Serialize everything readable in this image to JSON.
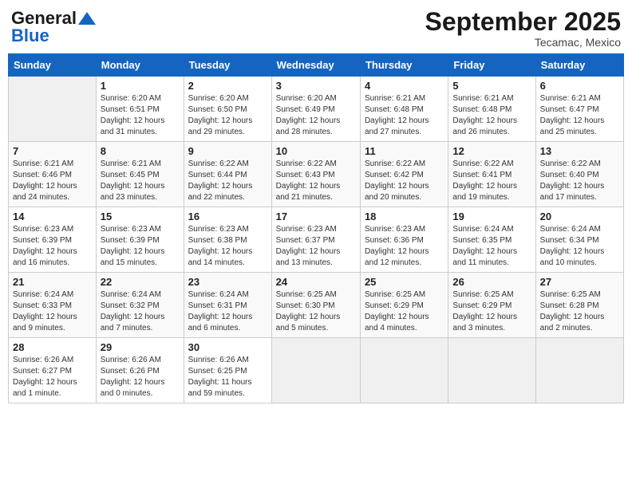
{
  "header": {
    "logo_line1": "General",
    "logo_line2": "Blue",
    "month_title": "September 2025",
    "location": "Tecamac, Mexico"
  },
  "weekdays": [
    "Sunday",
    "Monday",
    "Tuesday",
    "Wednesday",
    "Thursday",
    "Friday",
    "Saturday"
  ],
  "weeks": [
    [
      {
        "day": "",
        "info": ""
      },
      {
        "day": "1",
        "info": "Sunrise: 6:20 AM\nSunset: 6:51 PM\nDaylight: 12 hours\nand 31 minutes."
      },
      {
        "day": "2",
        "info": "Sunrise: 6:20 AM\nSunset: 6:50 PM\nDaylight: 12 hours\nand 29 minutes."
      },
      {
        "day": "3",
        "info": "Sunrise: 6:20 AM\nSunset: 6:49 PM\nDaylight: 12 hours\nand 28 minutes."
      },
      {
        "day": "4",
        "info": "Sunrise: 6:21 AM\nSunset: 6:48 PM\nDaylight: 12 hours\nand 27 minutes."
      },
      {
        "day": "5",
        "info": "Sunrise: 6:21 AM\nSunset: 6:48 PM\nDaylight: 12 hours\nand 26 minutes."
      },
      {
        "day": "6",
        "info": "Sunrise: 6:21 AM\nSunset: 6:47 PM\nDaylight: 12 hours\nand 25 minutes."
      }
    ],
    [
      {
        "day": "7",
        "info": "Sunrise: 6:21 AM\nSunset: 6:46 PM\nDaylight: 12 hours\nand 24 minutes."
      },
      {
        "day": "8",
        "info": "Sunrise: 6:21 AM\nSunset: 6:45 PM\nDaylight: 12 hours\nand 23 minutes."
      },
      {
        "day": "9",
        "info": "Sunrise: 6:22 AM\nSunset: 6:44 PM\nDaylight: 12 hours\nand 22 minutes."
      },
      {
        "day": "10",
        "info": "Sunrise: 6:22 AM\nSunset: 6:43 PM\nDaylight: 12 hours\nand 21 minutes."
      },
      {
        "day": "11",
        "info": "Sunrise: 6:22 AM\nSunset: 6:42 PM\nDaylight: 12 hours\nand 20 minutes."
      },
      {
        "day": "12",
        "info": "Sunrise: 6:22 AM\nSunset: 6:41 PM\nDaylight: 12 hours\nand 19 minutes."
      },
      {
        "day": "13",
        "info": "Sunrise: 6:22 AM\nSunset: 6:40 PM\nDaylight: 12 hours\nand 17 minutes."
      }
    ],
    [
      {
        "day": "14",
        "info": "Sunrise: 6:23 AM\nSunset: 6:39 PM\nDaylight: 12 hours\nand 16 minutes."
      },
      {
        "day": "15",
        "info": "Sunrise: 6:23 AM\nSunset: 6:39 PM\nDaylight: 12 hours\nand 15 minutes."
      },
      {
        "day": "16",
        "info": "Sunrise: 6:23 AM\nSunset: 6:38 PM\nDaylight: 12 hours\nand 14 minutes."
      },
      {
        "day": "17",
        "info": "Sunrise: 6:23 AM\nSunset: 6:37 PM\nDaylight: 12 hours\nand 13 minutes."
      },
      {
        "day": "18",
        "info": "Sunrise: 6:23 AM\nSunset: 6:36 PM\nDaylight: 12 hours\nand 12 minutes."
      },
      {
        "day": "19",
        "info": "Sunrise: 6:24 AM\nSunset: 6:35 PM\nDaylight: 12 hours\nand 11 minutes."
      },
      {
        "day": "20",
        "info": "Sunrise: 6:24 AM\nSunset: 6:34 PM\nDaylight: 12 hours\nand 10 minutes."
      }
    ],
    [
      {
        "day": "21",
        "info": "Sunrise: 6:24 AM\nSunset: 6:33 PM\nDaylight: 12 hours\nand 9 minutes."
      },
      {
        "day": "22",
        "info": "Sunrise: 6:24 AM\nSunset: 6:32 PM\nDaylight: 12 hours\nand 7 minutes."
      },
      {
        "day": "23",
        "info": "Sunrise: 6:24 AM\nSunset: 6:31 PM\nDaylight: 12 hours\nand 6 minutes."
      },
      {
        "day": "24",
        "info": "Sunrise: 6:25 AM\nSunset: 6:30 PM\nDaylight: 12 hours\nand 5 minutes."
      },
      {
        "day": "25",
        "info": "Sunrise: 6:25 AM\nSunset: 6:29 PM\nDaylight: 12 hours\nand 4 minutes."
      },
      {
        "day": "26",
        "info": "Sunrise: 6:25 AM\nSunset: 6:29 PM\nDaylight: 12 hours\nand 3 minutes."
      },
      {
        "day": "27",
        "info": "Sunrise: 6:25 AM\nSunset: 6:28 PM\nDaylight: 12 hours\nand 2 minutes."
      }
    ],
    [
      {
        "day": "28",
        "info": "Sunrise: 6:26 AM\nSunset: 6:27 PM\nDaylight: 12 hours\nand 1 minute."
      },
      {
        "day": "29",
        "info": "Sunrise: 6:26 AM\nSunset: 6:26 PM\nDaylight: 12 hours\nand 0 minutes."
      },
      {
        "day": "30",
        "info": "Sunrise: 6:26 AM\nSunset: 6:25 PM\nDaylight: 11 hours\nand 59 minutes."
      },
      {
        "day": "",
        "info": ""
      },
      {
        "day": "",
        "info": ""
      },
      {
        "day": "",
        "info": ""
      },
      {
        "day": "",
        "info": ""
      }
    ]
  ]
}
